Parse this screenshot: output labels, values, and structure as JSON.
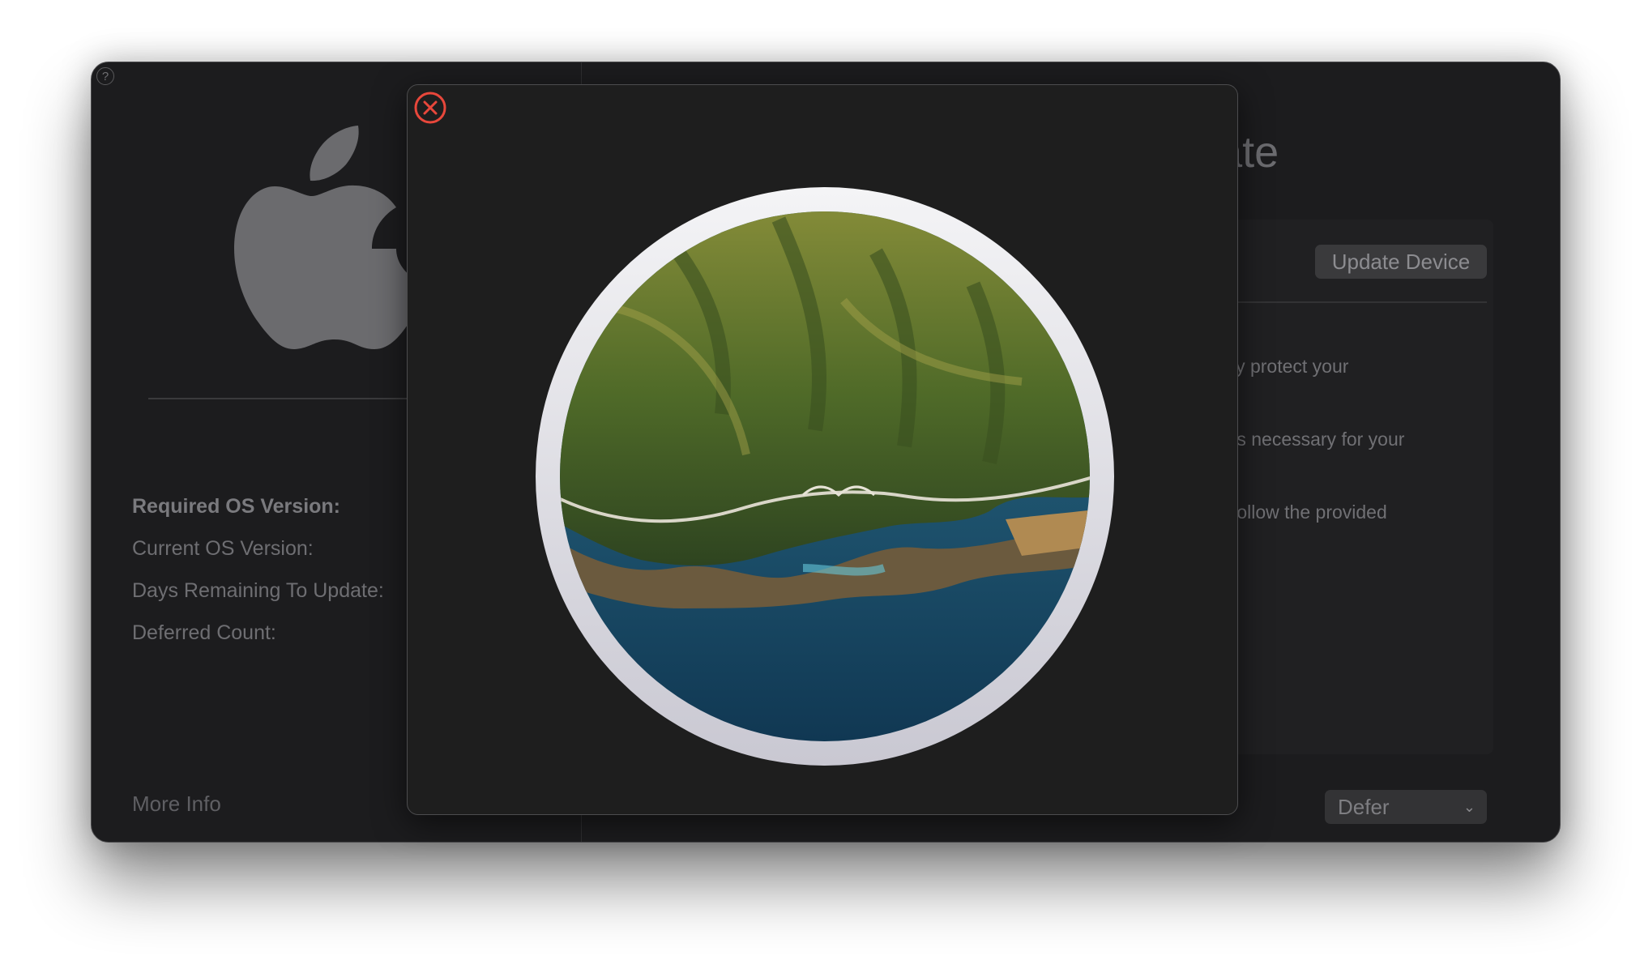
{
  "window": {
    "help_glyph": "?",
    "title_partial": "pdate",
    "info_labels": [
      "Required OS Version:",
      "Current OS Version:",
      "Days Remaining To Update:",
      "Deferred Count:"
    ],
    "more_info_label": "More Info",
    "update_button_label": "Update Device",
    "body_lines": [
      "ately protect your",
      "tems necessary for your",
      "nd follow the provided"
    ],
    "defer_select_value": "Defer",
    "defer_chevron": "⌄"
  },
  "modal": {
    "close_icon": "close-icon",
    "image_icon": "macos-big-sur-icon",
    "close_color": "#e8473b"
  },
  "colors": {
    "window_bg": "#1c1c1e",
    "modal_bg": "#1e1e1e",
    "accent_red": "#e8473b"
  }
}
